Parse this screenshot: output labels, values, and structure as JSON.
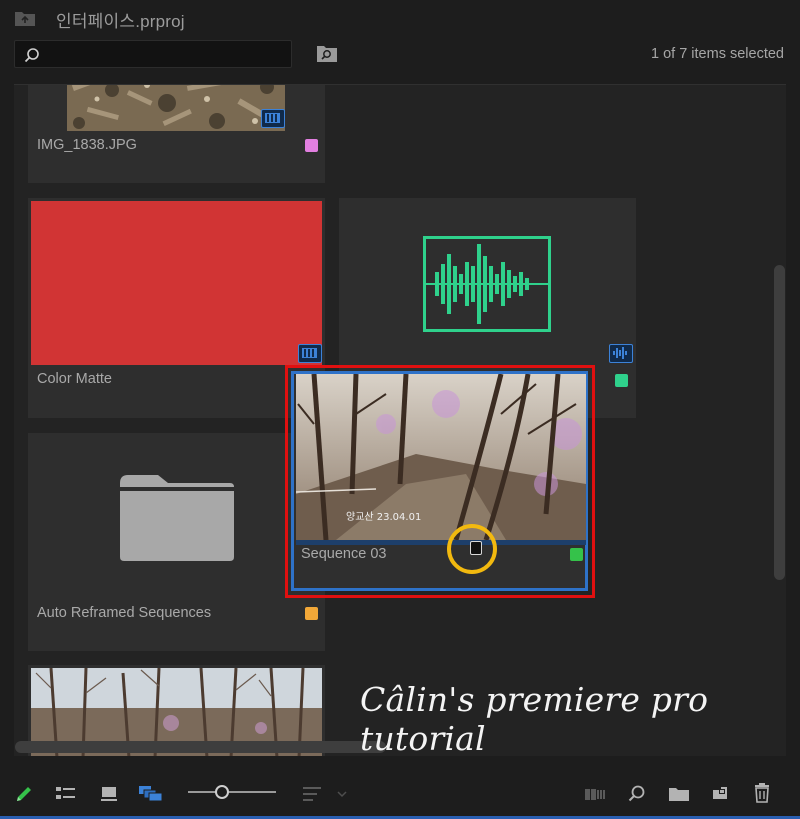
{
  "header": {
    "title": "인터페이스.prproj"
  },
  "search": {
    "value": "",
    "placeholder": ""
  },
  "status": {
    "selected": "1 of 7 items selected"
  },
  "items": [
    {
      "name": "IMG_1838.JPG",
      "swatch": "#e27fe0",
      "badge": "video-badge-icon"
    },
    {
      "name": "Color Matte",
      "swatch": "#d13434",
      "badge": "video-badge-icon"
    },
    {
      "name": "",
      "swatch": "#2fd18c",
      "badge": "audio-badge-icon"
    },
    {
      "name": "Sequence 03",
      "swatch": "#35c24a",
      "badge": ""
    },
    {
      "name": "Auto Reframed Sequences",
      "swatch": "#f2a838",
      "badge": ""
    },
    {
      "name": "",
      "swatch": "",
      "badge": ""
    }
  ],
  "overlay": {
    "thumb_caption": "양교산 23.04.01",
    "watermark": "Câlin's premiere pro tutorial"
  },
  "toolbar": {
    "buttons": [
      "pencil-icon",
      "list-view-icon",
      "icon-view-icon",
      "freeform-view-icon",
      "zoom-slider",
      "sort-icon",
      "automate-icon",
      "find-icon",
      "new-bin-icon",
      "new-item-icon",
      "trash-icon"
    ],
    "zoom_level": 0.36
  },
  "colors": {
    "accent": "#2e72c8",
    "highlight": "#e01010",
    "ring": "#f2b90f",
    "audio": "#2fd18c"
  }
}
